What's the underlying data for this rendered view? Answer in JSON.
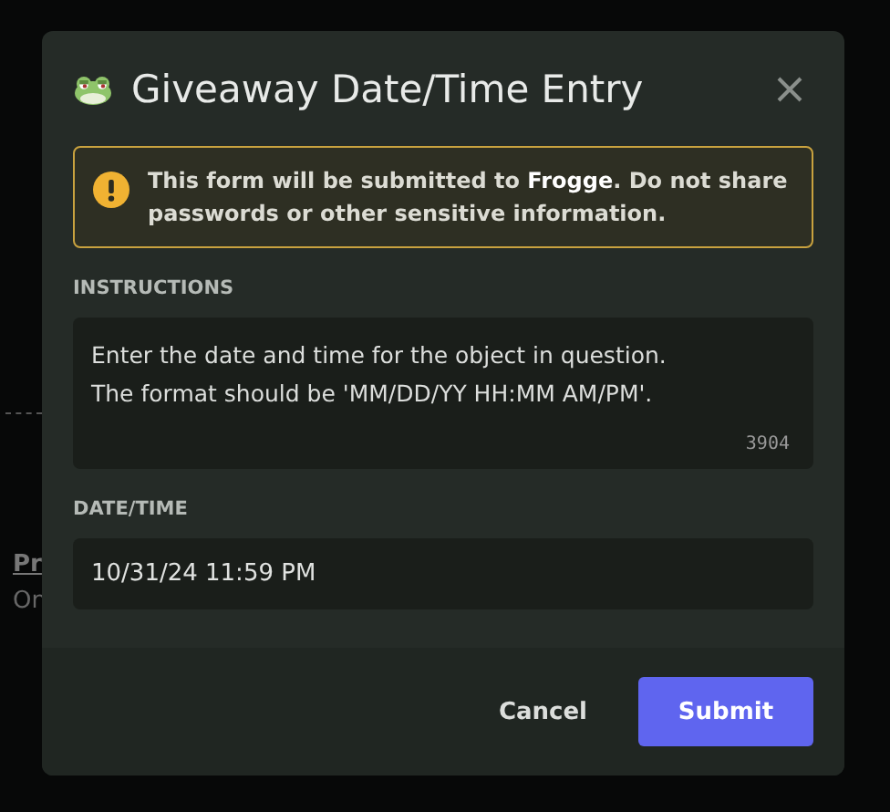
{
  "background": {
    "texts": [
      "Pr",
      "On"
    ]
  },
  "dialog": {
    "title": "Giveaway Date/Time Entry",
    "warning": "This form will be submitted to **Frogge**. Do not share passwords or other sensitive information.",
    "fields": [
      {
        "label": "INSTRUCTIONS",
        "kind": "textarea",
        "value": "Enter the date and time for the object in question.\nThe format should be 'MM/DD/YY HH:MM AM/PM'.",
        "counter": "3904"
      },
      {
        "label": "DATE/TIME",
        "kind": "input",
        "value": "10/31/24 11:59 PM"
      }
    ],
    "buttons": [
      {
        "label": "Cancel",
        "kind": "secondary"
      },
      {
        "label": "Submit",
        "kind": "primary"
      }
    ]
  }
}
